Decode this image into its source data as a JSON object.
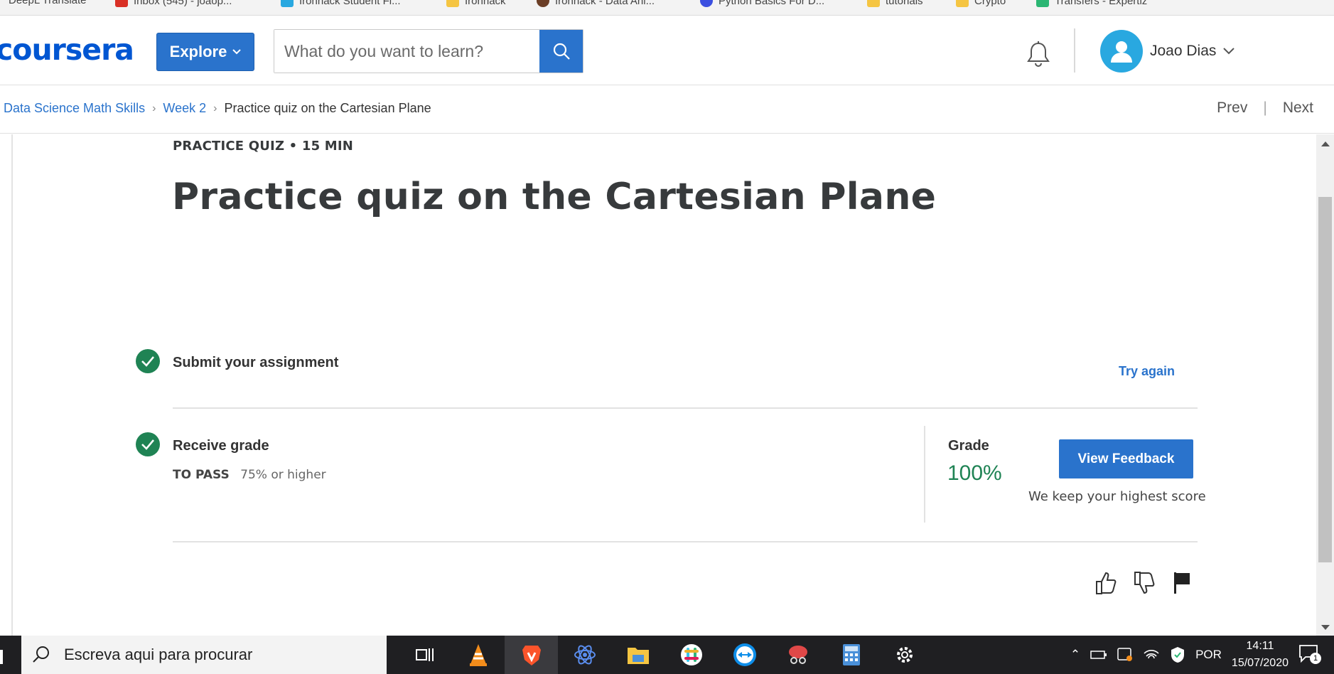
{
  "bookmarks": [
    "DeepL Translate",
    "Inbox (545) - joaop...",
    "Ironhack Student Fi...",
    "Ironhack",
    "Ironhack - Data Anl...",
    "Python Basics For D...",
    "tutorials",
    "Crypto",
    "Transfers - Expertiz"
  ],
  "header": {
    "logo": "coursera",
    "explore_label": "Explore",
    "search_placeholder": "What do you want to learn?",
    "user_name": "Joao Dias"
  },
  "breadcrumb": {
    "items": [
      "Data Science Math Skills",
      "Week 2"
    ],
    "current": "Practice quiz on the Cartesian Plane"
  },
  "nav": {
    "prev": "Prev",
    "next": "Next",
    "separator": "|"
  },
  "quiz": {
    "kicker": "PRACTICE QUIZ • 15 MIN",
    "title": "Practice quiz on the Cartesian Plane",
    "submit_label": "Submit your assignment",
    "try_again": "Try again",
    "receive_label": "Receive grade",
    "to_pass_label": "TO PASS",
    "to_pass_value": "75% or higher",
    "grade_label": "Grade",
    "grade_value": "100%",
    "view_feedback": "View Feedback",
    "keep_text": "We keep your highest score"
  },
  "taskbar": {
    "search_placeholder": "Escreva aqui para procurar",
    "language": "POR",
    "time": "14:11",
    "date": "15/07/2020",
    "notification_count": "1"
  },
  "colors": {
    "accent": "#2a73cc",
    "success": "#1f8354",
    "brand": "#0056d2"
  }
}
